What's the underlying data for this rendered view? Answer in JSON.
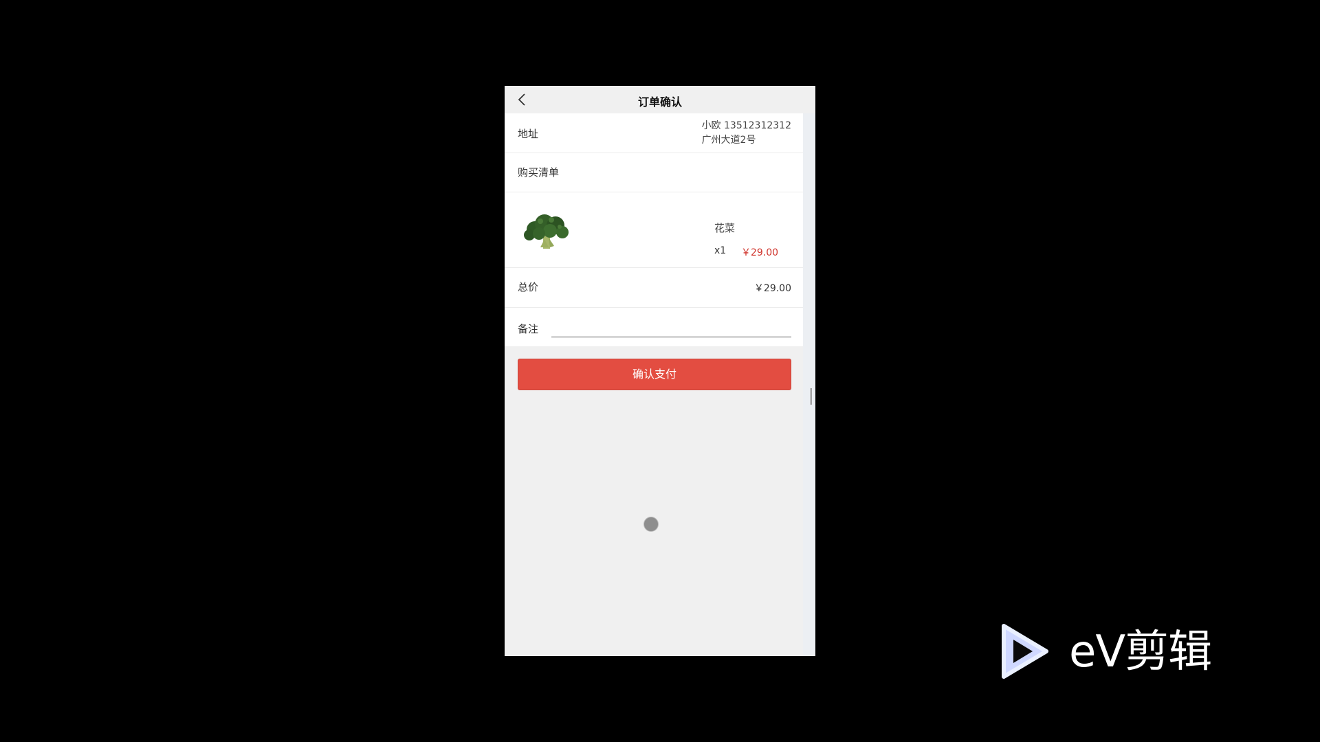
{
  "header": {
    "title": "订单确认",
    "back_icon": "chevron-left-icon"
  },
  "address": {
    "label": "地址",
    "name_phone": "小欧 13512312312",
    "street": "广州大道2号"
  },
  "shopping_list": {
    "label": "购买清单"
  },
  "item": {
    "name": "花菜",
    "qty": "x1",
    "price": "￥29.00",
    "image_icon": "broccoli-image"
  },
  "total": {
    "label": "总价",
    "value": "￥29.00"
  },
  "note": {
    "label": "备注",
    "value": ""
  },
  "actions": {
    "pay_label": "确认支付"
  },
  "colors": {
    "accent": "#e34d41",
    "price": "#d0342c"
  },
  "watermark": {
    "text": "eV剪辑"
  }
}
